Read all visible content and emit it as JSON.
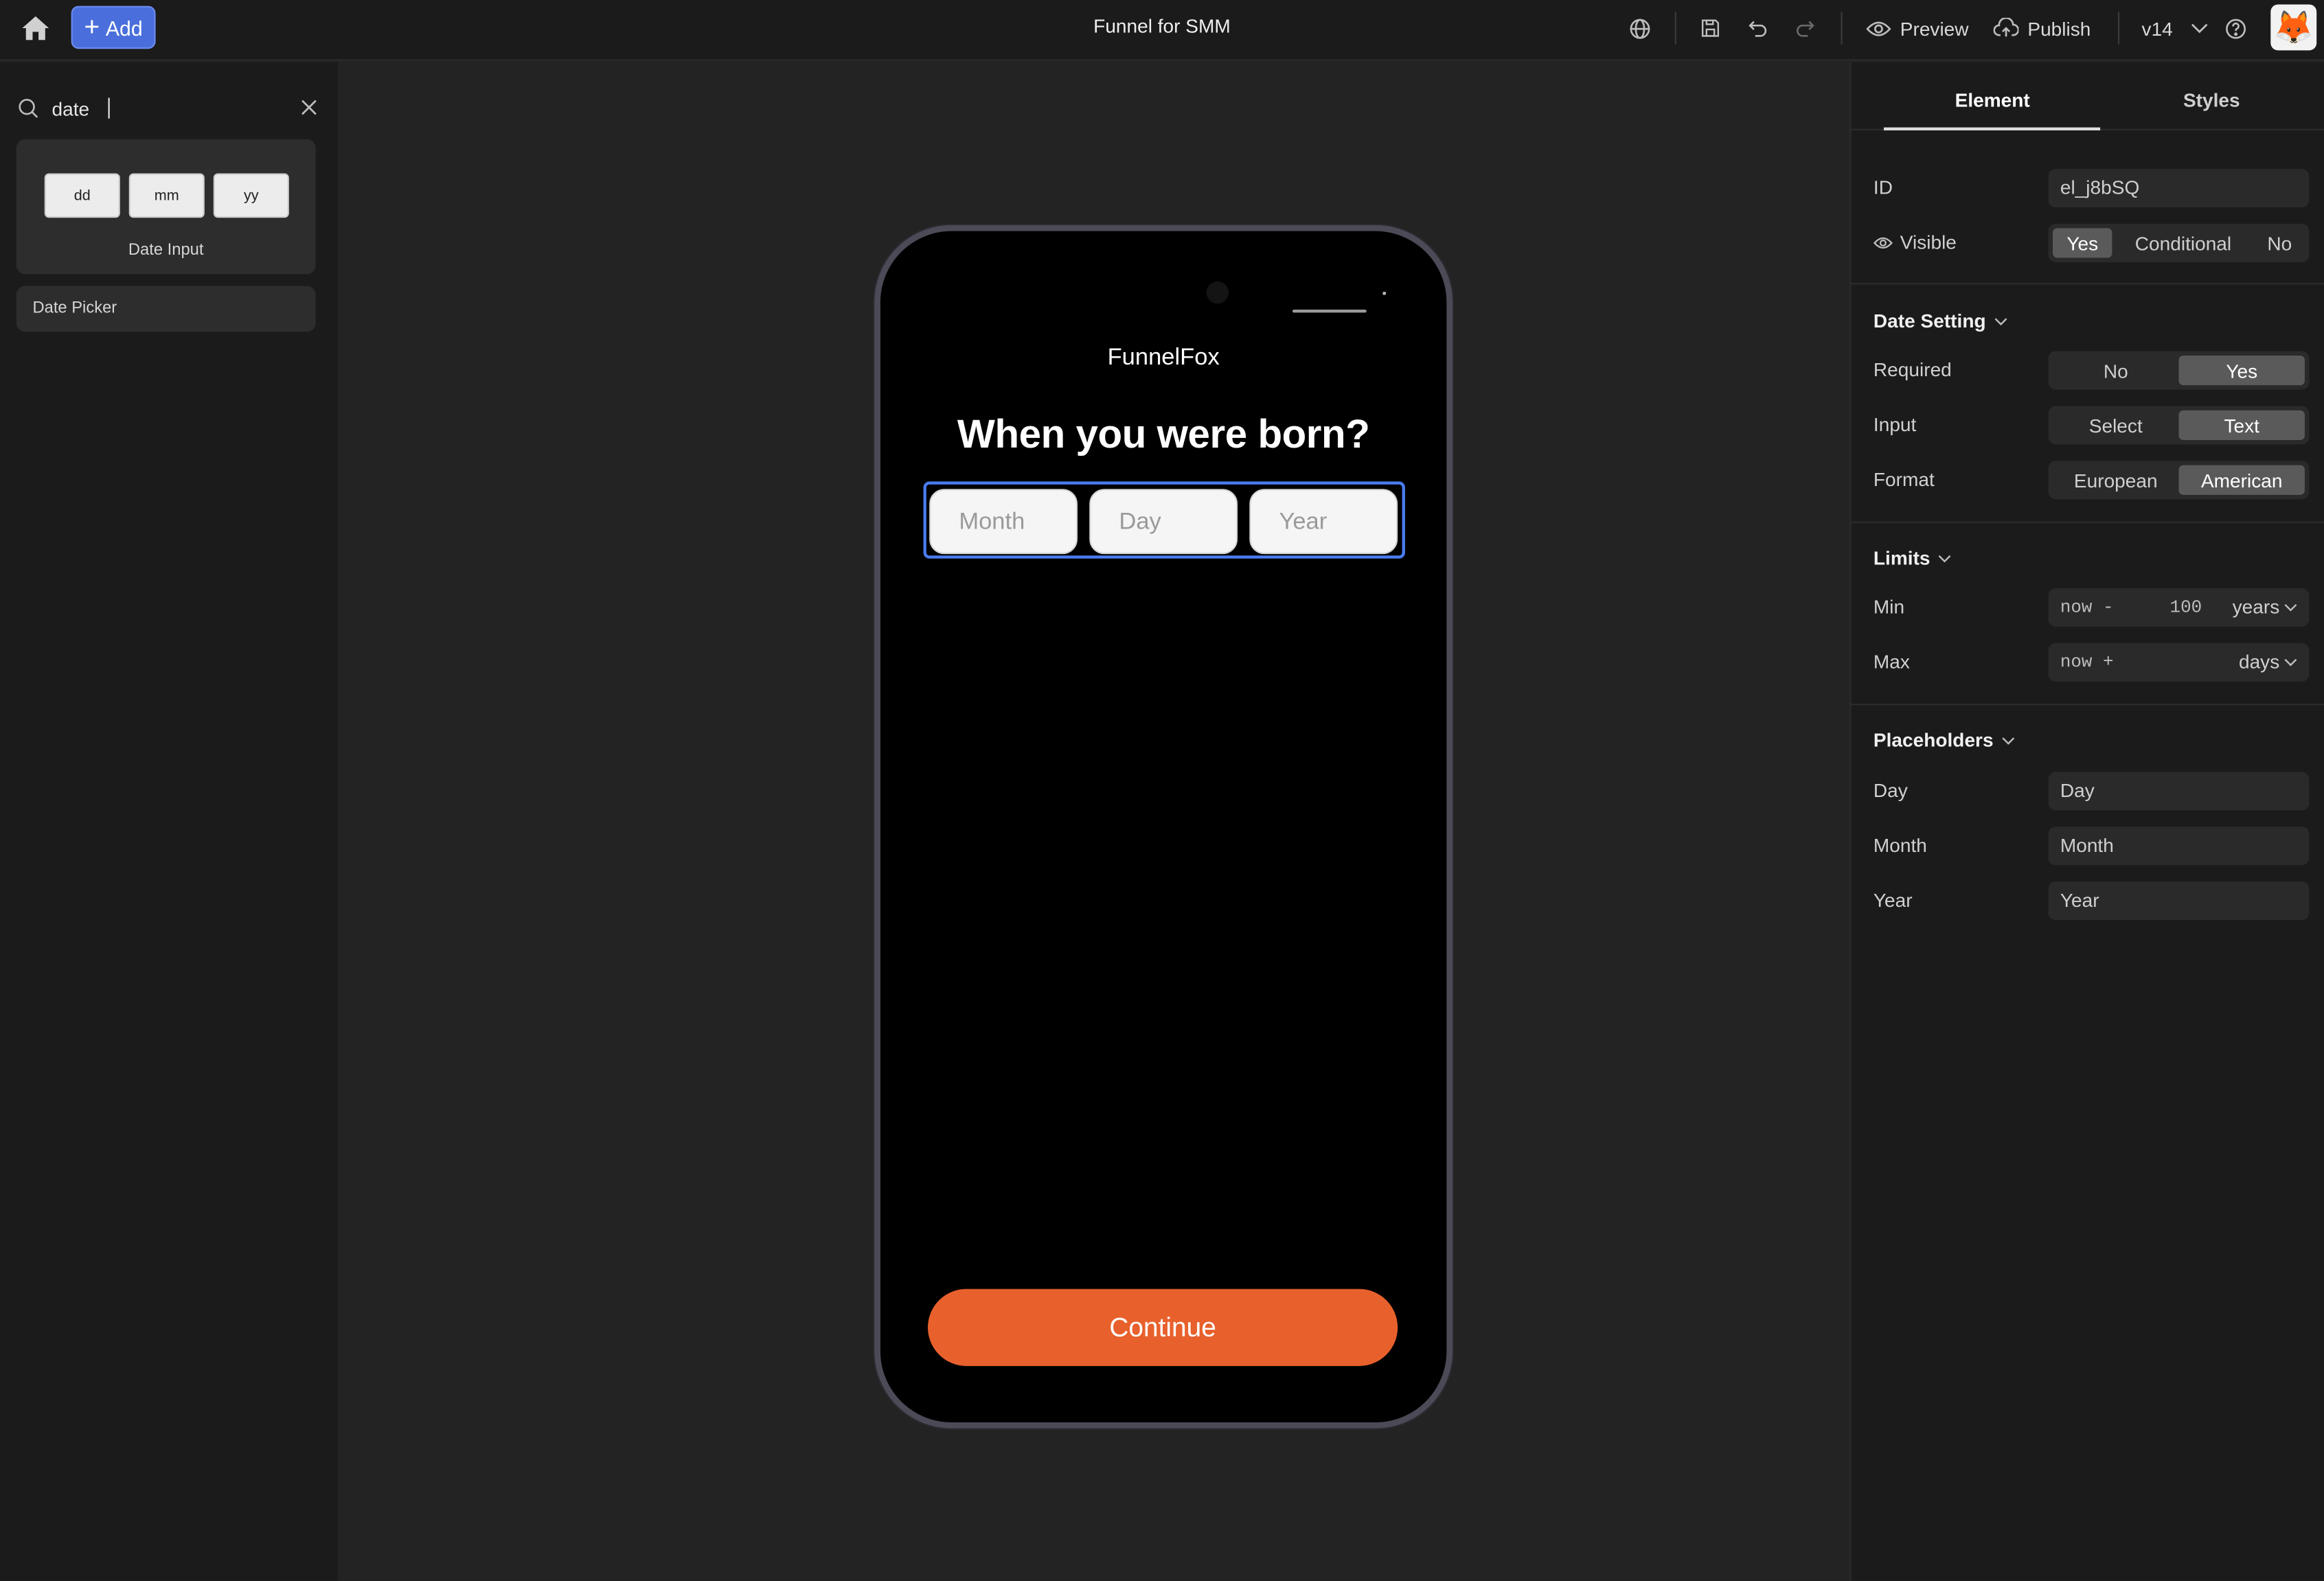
{
  "app": {
    "title": "Funnel for SMM",
    "add_label": "Add",
    "preview_label": "Preview",
    "publish_label": "Publish",
    "version": "v14",
    "avatar": "🦊"
  },
  "left": {
    "search": {
      "value": "date",
      "placeholder": ""
    },
    "results": [
      {
        "label": "Date Input",
        "boxes": [
          "dd",
          "mm",
          "yy"
        ]
      },
      {
        "label": "Date Picker"
      }
    ]
  },
  "phone": {
    "brand": "FunnelFox",
    "question": "When you were born?",
    "fields": {
      "month": "Month",
      "day": "Day",
      "year": "Year"
    },
    "continue_label": "Continue"
  },
  "panel": {
    "tabs": [
      "Element",
      "Styles"
    ],
    "active_tab": "Element",
    "id": {
      "label": "ID",
      "value": "el_j8bSQ"
    },
    "visible": {
      "label": "Visible",
      "options": [
        "Yes",
        "Conditional",
        "No"
      ],
      "selected": "Yes"
    },
    "date_setting": {
      "title": "Date Setting",
      "required": {
        "label": "Required",
        "options": [
          "No",
          "Yes"
        ],
        "selected": "Yes"
      },
      "input": {
        "label": "Input",
        "options": [
          "Select",
          "Text"
        ],
        "selected": "Text"
      },
      "format": {
        "label": "Format",
        "options": [
          "European",
          "American"
        ],
        "selected": "American"
      }
    },
    "limits": {
      "title": "Limits",
      "min": {
        "label": "Min",
        "op": "now -",
        "value": "100",
        "unit": "years"
      },
      "max": {
        "label": "Max",
        "op": "now +",
        "value": "",
        "unit": "days"
      }
    },
    "placeholders": {
      "title": "Placeholders",
      "day": {
        "label": "Day",
        "value": "Day"
      },
      "month": {
        "label": "Month",
        "value": "Month"
      },
      "year": {
        "label": "Year",
        "value": "Year"
      }
    }
  },
  "colors": {
    "accent": "#4a6fdc",
    "cta": "#e8612c",
    "selection": "#4a7cf0",
    "bg": "#232323",
    "panel_bg": "#1b1b1b"
  }
}
